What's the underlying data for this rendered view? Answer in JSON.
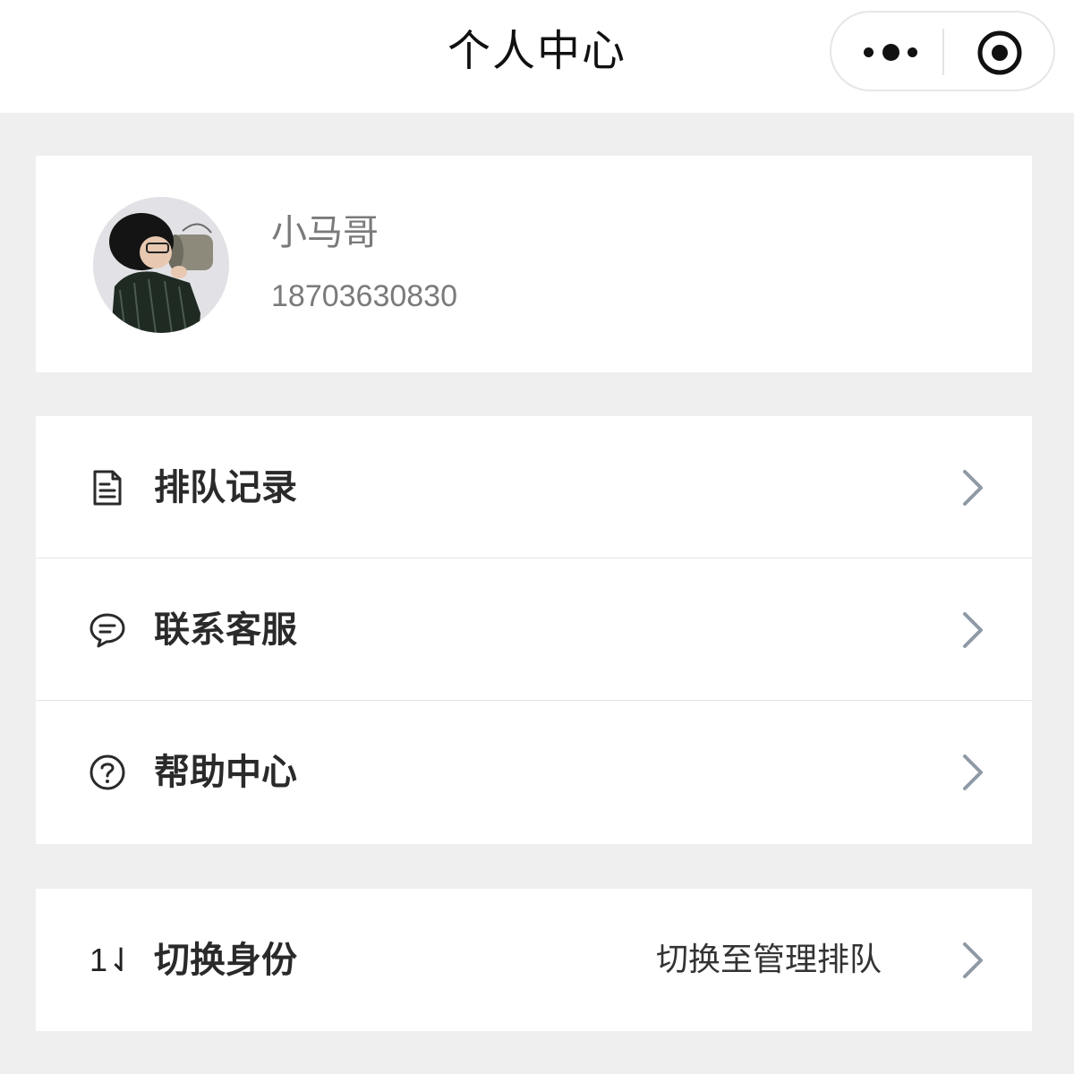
{
  "nav": {
    "title": "个人中心",
    "more_icon": "more-dots-icon",
    "close_icon": "target-circle-icon"
  },
  "profile": {
    "name": "小马哥",
    "phone": "18703630830",
    "avatar_icon": "avatar-photo"
  },
  "menu": {
    "items": [
      {
        "icon": "document-icon",
        "label": "排队记录"
      },
      {
        "icon": "chat-bubble-icon",
        "label": "联系客服"
      },
      {
        "icon": "help-circle-icon",
        "label": "帮助中心"
      }
    ]
  },
  "switch_identity": {
    "icon_text": "1⇃",
    "label": "切换身份",
    "value": "切换至管理排队"
  },
  "colors": {
    "background": "#efefef",
    "card": "#ffffff",
    "chevron": "#8f9aa6",
    "secondary_text": "#7a7a7a"
  }
}
